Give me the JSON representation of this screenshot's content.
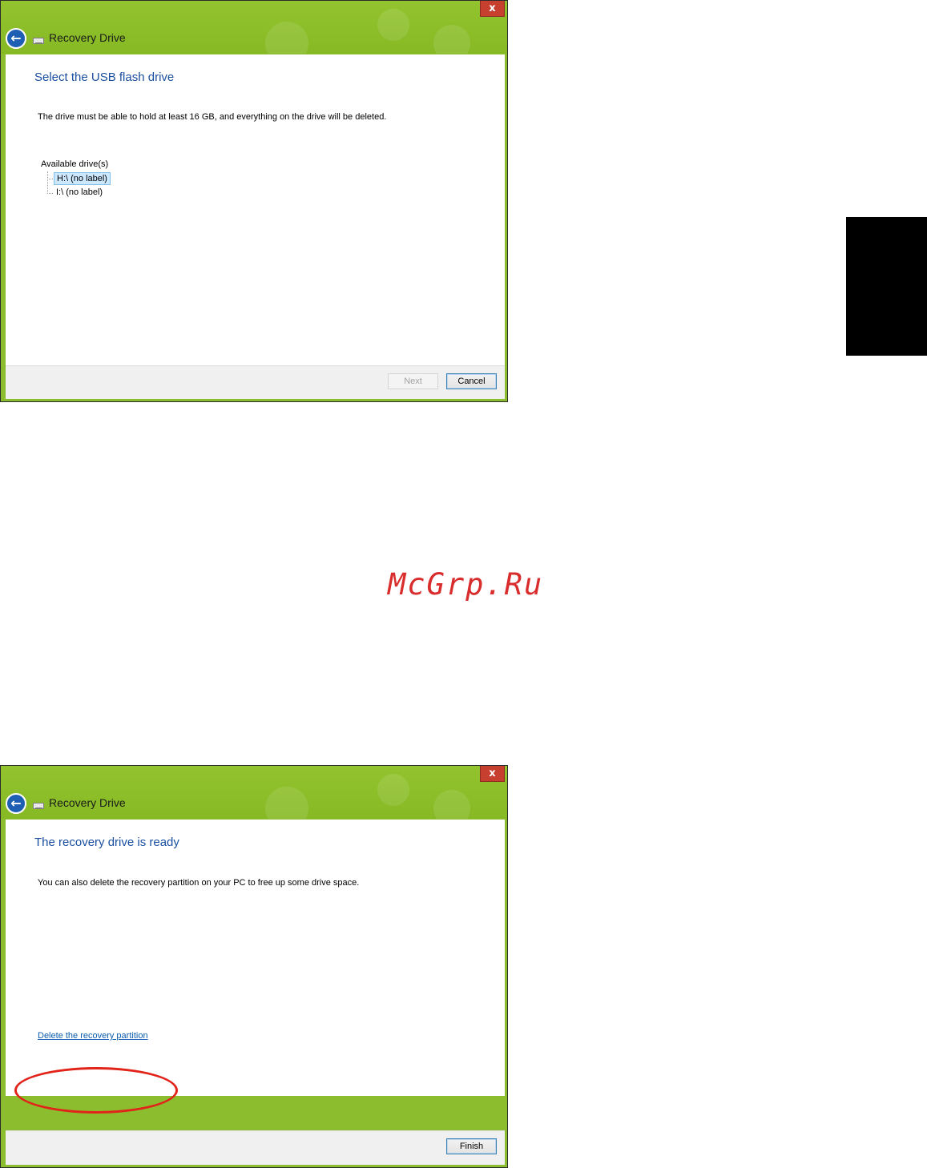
{
  "window1": {
    "title": "Recovery Drive",
    "close_symbol": "x",
    "heading": "Select the USB flash drive",
    "description": "The drive must be able to hold at least 16 GB, and everything on the drive will be deleted.",
    "tree": {
      "root_label": "Available drive(s)",
      "items": [
        {
          "label": "H:\\ (no label)",
          "selected": true
        },
        {
          "label": "I:\\ (no label)",
          "selected": false
        }
      ]
    },
    "buttons": {
      "next": "Next",
      "cancel": "Cancel"
    }
  },
  "window2": {
    "title": "Recovery Drive",
    "close_symbol": "x",
    "heading": "The recovery drive is ready",
    "description": "You can also delete the recovery partition on your PC to free up some drive space.",
    "link": "Delete the recovery partition",
    "buttons": {
      "finish": "Finish"
    }
  },
  "watermark": "McGrp.Ru",
  "icons": {
    "back": "back-arrow-icon",
    "drive": "drive-icon",
    "close": "close-icon"
  },
  "colors": {
    "titlebar": "#8bbd2e",
    "heading": "#1a4fa0",
    "link": "#0b5cad",
    "annotation": "#e2231a",
    "watermark": "#d92d2d"
  }
}
